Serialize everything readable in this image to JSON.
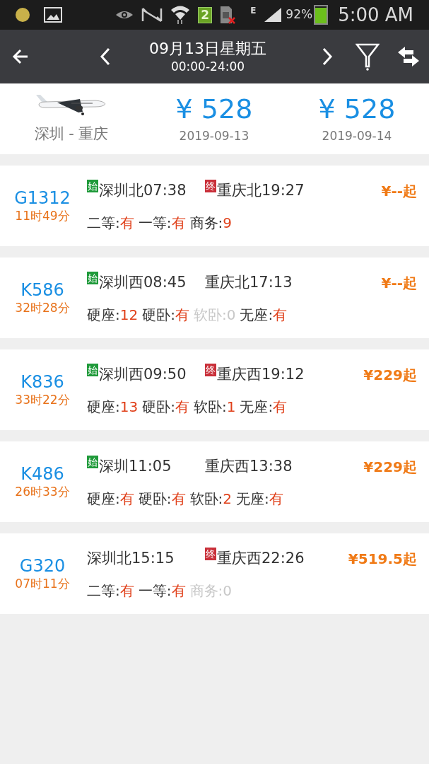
{
  "status_bar": {
    "network": "E",
    "sim_slot": "2",
    "battery_text": "92%",
    "time": "5:00 AM"
  },
  "header": {
    "date": "09月13日星期五",
    "time_range": "00:00-24:00"
  },
  "flight": {
    "route": "深圳 - 重庆",
    "fares": [
      {
        "price": "¥ 528",
        "date": "2019-09-13"
      },
      {
        "price": "¥ 528",
        "date": "2019-09-14"
      }
    ]
  },
  "trains": [
    {
      "number": "G1312",
      "duration": "11时49分",
      "depart": {
        "badge": "始",
        "station": "深圳北07:38"
      },
      "arrive": {
        "badge": "终",
        "station": "重庆北19:27"
      },
      "price": "¥--起",
      "seats": [
        {
          "label": "二等:",
          "value": "有",
          "available": true
        },
        {
          "label": "一等:",
          "value": "有",
          "available": true
        },
        {
          "label": "商务:",
          "value": "9",
          "available": true
        }
      ]
    },
    {
      "number": "K586",
      "duration": "32时28分",
      "depart": {
        "badge": "始",
        "station": "深圳西08:45"
      },
      "arrive": {
        "station": "重庆北17:13"
      },
      "price": "¥--起",
      "seats": [
        {
          "label": "硬座:",
          "value": "12",
          "available": true
        },
        {
          "label": "硬卧:",
          "value": "有",
          "available": true
        },
        {
          "label": "软卧:",
          "value": "0",
          "available": false
        },
        {
          "label": "无座:",
          "value": "有",
          "available": true
        }
      ]
    },
    {
      "number": "K836",
      "duration": "33时22分",
      "depart": {
        "badge": "始",
        "station": "深圳西09:50"
      },
      "arrive": {
        "badge": "终",
        "station": "重庆西19:12"
      },
      "price": "¥229起",
      "seats": [
        {
          "label": "硬座:",
          "value": "13",
          "available": true
        },
        {
          "label": "硬卧:",
          "value": "有",
          "available": true
        },
        {
          "label": "软卧:",
          "value": "1",
          "available": true
        },
        {
          "label": "无座:",
          "value": "有",
          "available": true
        }
      ]
    },
    {
      "number": "K486",
      "duration": "26时33分",
      "depart": {
        "badge": "始",
        "station": "深圳11:05"
      },
      "arrive": {
        "station": "重庆西13:38"
      },
      "price": "¥229起",
      "seats": [
        {
          "label": "硬座:",
          "value": "有",
          "available": true
        },
        {
          "label": "硬卧:",
          "value": "有",
          "available": true
        },
        {
          "label": "软卧:",
          "value": "2",
          "available": true
        },
        {
          "label": "无座:",
          "value": "有",
          "available": true
        }
      ]
    },
    {
      "number": "G320",
      "duration": "07时11分",
      "depart": {
        "station": "深圳北15:15"
      },
      "arrive": {
        "badge": "终",
        "station": "重庆西22:26"
      },
      "price": "¥519.5起",
      "seats": [
        {
          "label": "二等:",
          "value": "有",
          "available": true
        },
        {
          "label": "一等:",
          "value": "有",
          "available": true
        },
        {
          "label": "商务:",
          "value": "0",
          "available": false
        }
      ]
    }
  ]
}
